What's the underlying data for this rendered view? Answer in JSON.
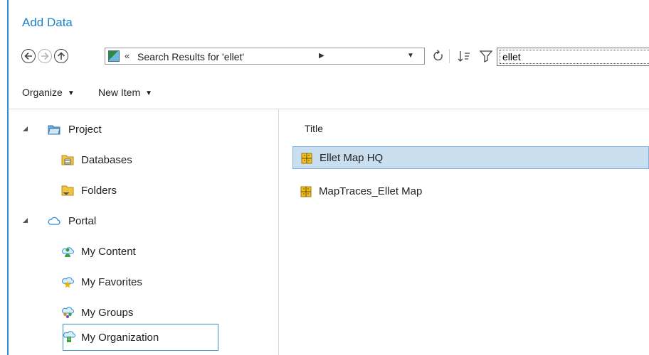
{
  "window": {
    "title": "Add Data"
  },
  "toolbar": {
    "location_text": "Search Results for 'ellet'",
    "search_value": "ellet"
  },
  "menu": {
    "organize_label": "Organize",
    "new_item_label": "New Item"
  },
  "tree": {
    "project": {
      "label": "Project",
      "children": [
        {
          "label": "Databases"
        },
        {
          "label": "Folders"
        }
      ]
    },
    "portal": {
      "label": "Portal",
      "children": [
        {
          "label": "My Content"
        },
        {
          "label": "My Favorites"
        },
        {
          "label": "My Groups"
        },
        {
          "label": "My Organization"
        }
      ]
    }
  },
  "results": {
    "column_title": "Title",
    "items": [
      {
        "title": "Ellet Map HQ",
        "selected": true
      },
      {
        "title": "MapTraces_Ellet Map",
        "selected": false
      }
    ]
  },
  "colors": {
    "accent": "#1d83c7",
    "selection": "#c9dff0",
    "selection_border": "#3b8bd0"
  }
}
